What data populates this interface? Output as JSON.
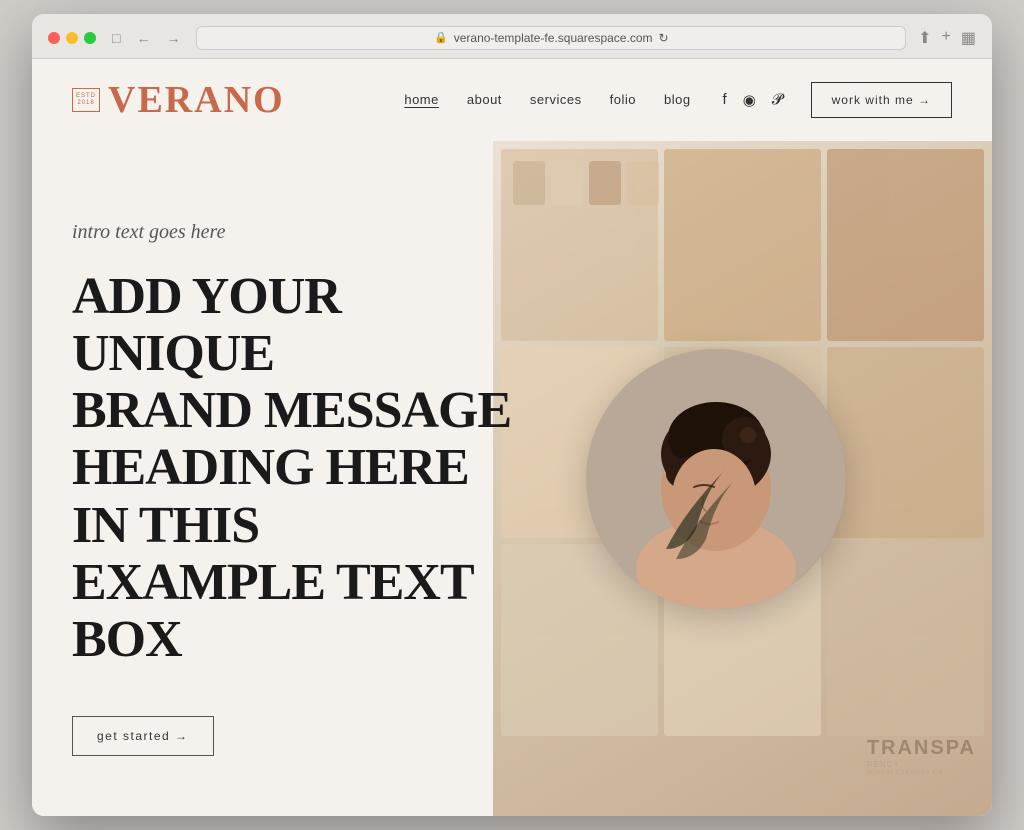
{
  "browser": {
    "url": "verano-template-fe.squarespace.com",
    "traffic_lights": [
      "red",
      "yellow",
      "green"
    ],
    "back_arrow": "←",
    "forward_arrow": "→",
    "reload_icon": "↻"
  },
  "header": {
    "logo_badge_lines": [
      "ESTD",
      "2018"
    ],
    "logo_text": "VERANO",
    "nav_links": [
      {
        "label": "home",
        "active": true
      },
      {
        "label": "about",
        "active": false
      },
      {
        "label": "services",
        "active": false
      },
      {
        "label": "folio",
        "active": false
      },
      {
        "label": "blog",
        "active": false
      }
    ],
    "social_icons": [
      "f",
      "◎",
      "𝒫"
    ],
    "cta_label": "work with me →"
  },
  "hero": {
    "intro_text": "intro text goes here",
    "heading_line1": "ADD YOUR UNIQUE",
    "heading_line2": "BRAND MESSAGE",
    "heading_line3": "HEADING HERE IN THIS",
    "heading_line4": "EXAMPLE TEXT BOX",
    "cta_button": "get started →"
  },
  "watermark": {
    "main": "TRANSPA",
    "sub": "RENCY"
  },
  "colors": {
    "accent": "#c8694a",
    "text_dark": "#1a1a1a",
    "text_medium": "#555",
    "bg": "#f5f2ee",
    "border": "#333"
  }
}
